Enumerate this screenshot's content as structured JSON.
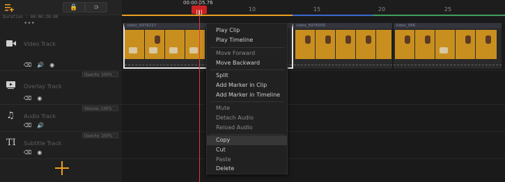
{
  "header": {
    "playhead_time": "00:00:05.76",
    "duration_label": "Duration : 00:00:28:08",
    "lock_icon": "lock-icon",
    "magnet_icon": "magnet-icon"
  },
  "ruler": {
    "ticks": [
      "10",
      "15",
      "20",
      "25"
    ]
  },
  "tracks": [
    {
      "name": "Video Track",
      "icon": "video-icon"
    },
    {
      "name": "Overlay Track",
      "icon": "overlay-icon",
      "opacity": "Opacity: 100%"
    },
    {
      "name": "Audio Track",
      "icon": "music-icon",
      "volume": "Volume: 100%"
    },
    {
      "name": "Subtitle Track",
      "icon": "text-icon",
      "opacity": "Opacity: 100%"
    }
  ],
  "clips": [
    {
      "label": "video_6976217"
    },
    {
      "label": "video_6976000"
    },
    {
      "label": "video_066"
    }
  ],
  "context_menu": {
    "items": [
      {
        "label": "Play Clip",
        "enabled": true
      },
      {
        "label": "Play Timeline",
        "enabled": true
      },
      {
        "label": "Move Forward",
        "enabled": false
      },
      {
        "label": "Move Backward",
        "enabled": true
      },
      {
        "label": "Split",
        "enabled": true
      },
      {
        "label": "Add Marker in Clip",
        "enabled": true
      },
      {
        "label": "Add Marker in Timeline",
        "enabled": true
      },
      {
        "label": "Mute",
        "enabled": false
      },
      {
        "label": "Detach Audio",
        "enabled": false
      },
      {
        "label": "Reload Audio",
        "enabled": false
      },
      {
        "label": "Copy",
        "enabled": true,
        "highlighted": true
      },
      {
        "label": "Cut",
        "enabled": true
      },
      {
        "label": "Paste",
        "enabled": false
      },
      {
        "label": "Delete",
        "enabled": true
      }
    ]
  },
  "colors": {
    "accent": "#f0a020",
    "playhead": "#e03a3a",
    "ruler_yellow": "#e8a020",
    "ruler_blue": "#3a6ad0",
    "ruler_green": "#40a060"
  }
}
